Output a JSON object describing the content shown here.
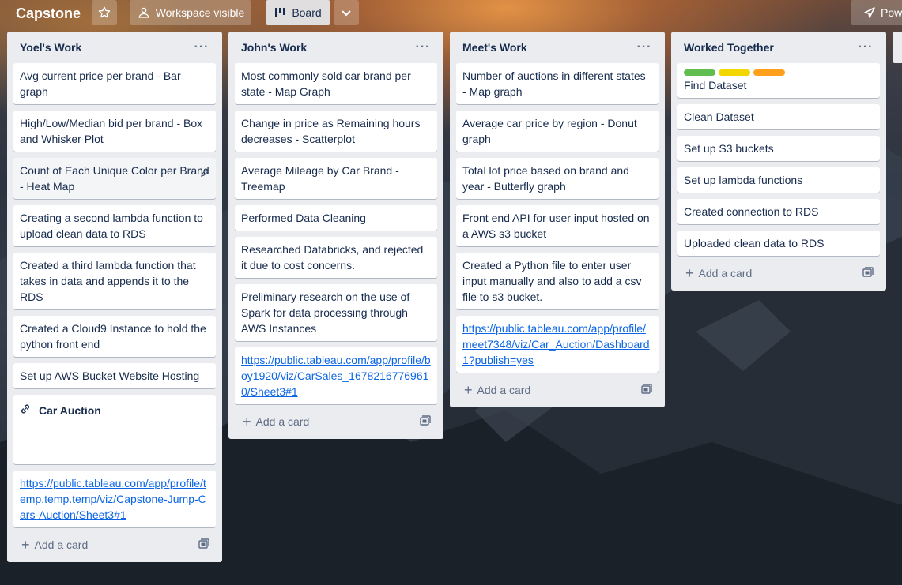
{
  "board": {
    "title": "Capstone",
    "visibility_label": "Workspace visible",
    "view_label": "Board",
    "power_label": "Pow"
  },
  "lists": [
    {
      "title": "Yoel's Work",
      "cards": [
        "Avg current price per brand - Bar graph",
        "High/Low/Median bid per brand - Box and Whisker Plot",
        "Count of Each Unique Color per Brand - Heat Map",
        "Creating a second lambda function to upload clean data to RDS",
        "Created a third lambda function that takes in data and appends it to the RDS",
        "Created a Cloud9 Instance to hold the python front end",
        "Set up AWS Bucket Website Hosting"
      ],
      "attachment_card": "Car Auction",
      "link_card": "https://public.tableau.com/app/profile/temp.temp.temp/viz/Capstone-Jump-Cars-Auction/Sheet3#1",
      "add_card": "Add a card"
    },
    {
      "title": "John's Work",
      "cards": [
        "Most commonly sold car brand per state - Map Graph",
        "Change in price as Remaining hours decreases - Scatterplot",
        "Average Mileage by Car Brand - Treemap",
        "Performed Data Cleaning",
        "Researched Databricks, and rejected it due to cost concerns.",
        "Preliminary research on the use of Spark for data processing through AWS Instances"
      ],
      "link_card": "https://public.tableau.com/app/profile/boy1920/viz/CarSales_16782167769610/Sheet3#1",
      "add_card": "Add a card"
    },
    {
      "title": "Meet's Work",
      "cards": [
        "Number of auctions in different states - Map graph",
        "Average car price by region - Donut graph",
        "Total lot price based on brand and year - Butterfly graph",
        "Front end API for user input hosted on a AWS s3 bucket",
        "Created a Python file to enter user input manually and also to add a csv file to s3 bucket."
      ],
      "link_card": "https://public.tableau.com/app/profile/meet7348/viz/Car_Auction/Dashboard1?publish=yes",
      "add_card": "Add a card"
    },
    {
      "title": "Worked Together",
      "label_colors": [
        "#61bd4f",
        "#f2d600",
        "#ff9f1a"
      ],
      "cards": [
        "Find Dataset",
        "Clean Dataset",
        "Set up S3 buckets",
        "Set up lambda functions",
        "Created connection to RDS",
        "Uploaded clean data to RDS"
      ],
      "add_card": "Add a card"
    }
  ]
}
